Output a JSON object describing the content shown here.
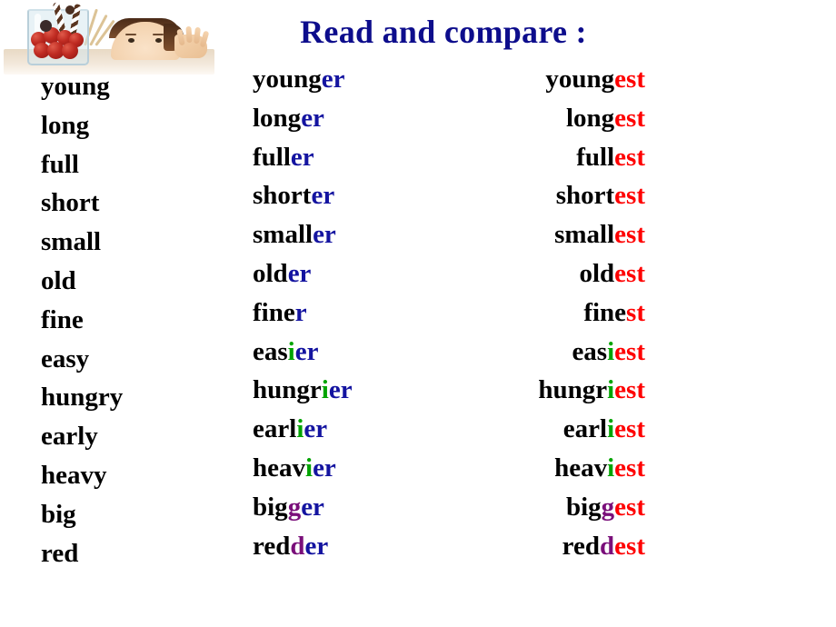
{
  "page": {
    "title": "Read and compare :",
    "title_color": "#0d0d8c",
    "background": "#ffffff"
  },
  "clipart": {
    "name": "child-with-jar-of-cherries-clipart",
    "description": "Glass jar filled with red cherries beside a child peeking over a table with hand reaching"
  },
  "colors": {
    "base": "#000000",
    "comparative_suffix": "#1414a0",
    "superlative_suffix": "#ff0000",
    "y_to_i": "#00a400",
    "doubled_consonant": "#7a0f7a"
  },
  "columns": {
    "base_header": "",
    "comparative_header": "",
    "superlative_header": ""
  },
  "rows": [
    {
      "base": "young",
      "comparative": [
        {
          "t": "young",
          "c": "black"
        },
        {
          "t": "er",
          "c": "blue"
        }
      ],
      "superlative": [
        {
          "t": "young",
          "c": "black"
        },
        {
          "t": "est",
          "c": "red"
        }
      ]
    },
    {
      "base": "long",
      "comparative": [
        {
          "t": "long",
          "c": "black"
        },
        {
          "t": "er",
          "c": "blue"
        }
      ],
      "superlative": [
        {
          "t": "long",
          "c": "black"
        },
        {
          "t": "est",
          "c": "red"
        }
      ]
    },
    {
      "base": "full",
      "comparative": [
        {
          "t": "full",
          "c": "black"
        },
        {
          "t": "er",
          "c": "blue"
        }
      ],
      "superlative": [
        {
          "t": "full",
          "c": "black"
        },
        {
          "t": "est",
          "c": "red"
        }
      ]
    },
    {
      "base": "short",
      "comparative": [
        {
          "t": "short",
          "c": "black"
        },
        {
          "t": "er",
          "c": "blue"
        }
      ],
      "superlative": [
        {
          "t": "short",
          "c": "black"
        },
        {
          "t": "est",
          "c": "red"
        }
      ]
    },
    {
      "base": "small",
      "comparative": [
        {
          "t": "small",
          "c": "black"
        },
        {
          "t": "er",
          "c": "blue"
        }
      ],
      "superlative": [
        {
          "t": "small",
          "c": "black"
        },
        {
          "t": "est",
          "c": "red"
        }
      ]
    },
    {
      "base": "old",
      "comparative": [
        {
          "t": "old",
          "c": "black"
        },
        {
          "t": "er",
          "c": "blue"
        }
      ],
      "superlative": [
        {
          "t": "old",
          "c": "black"
        },
        {
          "t": "est",
          "c": "red"
        }
      ]
    },
    {
      "base": "fine",
      "comparative": [
        {
          "t": "fine",
          "c": "black"
        },
        {
          "t": "r",
          "c": "blue"
        }
      ],
      "superlative": [
        {
          "t": "fine",
          "c": "black"
        },
        {
          "t": "st",
          "c": "red"
        }
      ]
    },
    {
      "base": "easy",
      "comparative": [
        {
          "t": "eas",
          "c": "black"
        },
        {
          "t": "i",
          "c": "green"
        },
        {
          "t": "er",
          "c": "blue"
        }
      ],
      "superlative": [
        {
          "t": "eas",
          "c": "black"
        },
        {
          "t": "i",
          "c": "green"
        },
        {
          "t": "est",
          "c": "red"
        }
      ]
    },
    {
      "base": "hungry",
      "comparative": [
        {
          "t": "hungr",
          "c": "black"
        },
        {
          "t": "i",
          "c": "green"
        },
        {
          "t": "er",
          "c": "blue"
        }
      ],
      "superlative": [
        {
          "t": "hungr",
          "c": "black"
        },
        {
          "t": "i",
          "c": "green"
        },
        {
          "t": "est",
          "c": "red"
        }
      ]
    },
    {
      "base": "early",
      "comparative": [
        {
          "t": "earl",
          "c": "black"
        },
        {
          "t": "i",
          "c": "green"
        },
        {
          "t": "er",
          "c": "blue"
        }
      ],
      "superlative": [
        {
          "t": "earl",
          "c": "black"
        },
        {
          "t": "i",
          "c": "green"
        },
        {
          "t": "est",
          "c": "red"
        }
      ]
    },
    {
      "base": "heavy",
      "comparative": [
        {
          "t": "heav",
          "c": "black"
        },
        {
          "t": "i",
          "c": "green"
        },
        {
          "t": "er",
          "c": "blue"
        }
      ],
      "superlative": [
        {
          "t": "heav",
          "c": "black"
        },
        {
          "t": "i",
          "c": "green"
        },
        {
          "t": "est",
          "c": "red"
        }
      ]
    },
    {
      "base": "big",
      "comparative": [
        {
          "t": "big",
          "c": "black"
        },
        {
          "t": "g",
          "c": "purple"
        },
        {
          "t": "er",
          "c": "blue"
        }
      ],
      "superlative": [
        {
          "t": "big",
          "c": "black"
        },
        {
          "t": "g",
          "c": "purple"
        },
        {
          "t": "est",
          "c": "red"
        }
      ]
    },
    {
      "base": "red",
      "comparative": [
        {
          "t": "red",
          "c": "black"
        },
        {
          "t": "d",
          "c": "purple"
        },
        {
          "t": "er",
          "c": "blue"
        }
      ],
      "superlative": [
        {
          "t": "red",
          "c": "black"
        },
        {
          "t": "d",
          "c": "purple"
        },
        {
          "t": "est",
          "c": "red"
        }
      ]
    }
  ]
}
